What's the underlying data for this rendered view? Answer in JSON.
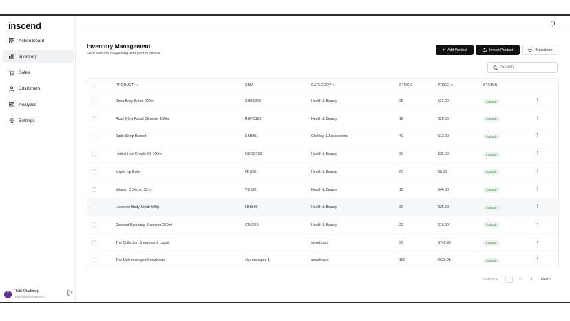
{
  "app": {
    "logo": "inscend"
  },
  "sidebar": {
    "items": [
      {
        "label": "Action Board",
        "icon": "grid-icon",
        "active": false
      },
      {
        "label": "Inventory",
        "icon": "chart-icon",
        "active": true
      },
      {
        "label": "Sales",
        "icon": "cart-icon",
        "active": false
      },
      {
        "label": "Customers",
        "icon": "users-icon",
        "active": false
      },
      {
        "label": "Analytics",
        "icon": "analytics-icon",
        "active": false
      },
      {
        "label": "Settings",
        "icon": "gear-icon",
        "active": false
      }
    ]
  },
  "user": {
    "initial": "T",
    "name": "Tobi Oladimeji",
    "email": "tobi@tobifeltbweese.i..."
  },
  "page": {
    "title": "Inventory Management",
    "subtitle": "Here's what's happening with your business."
  },
  "actions": {
    "add": "Add Product",
    "import": "Import Product",
    "brainstorm": "Brainstorm"
  },
  "search": {
    "placeholder": "Search"
  },
  "table": {
    "columns": {
      "product": "PRODUCT ↑↓",
      "sku": "SKU",
      "category": "CATEGORY ↑↓",
      "stock": "STOCK",
      "price": "PRICE ↑↓",
      "status": "STATUS"
    },
    "rows": [
      {
        "product": "Shea Body Butter 200ml",
        "sku": "SHBB200",
        "category": "Health & Beauty",
        "stock": "25",
        "price": "$22.00",
        "status": "In Stock"
      },
      {
        "product": "Rose Glow Facial Cleanser 150ml",
        "sku": "RGFC150",
        "category": "Health & Beauty",
        "stock": "18",
        "price": "$28.00",
        "status": "In Stock"
      },
      {
        "product": "Satin Sleep Bonnet",
        "sku": "SSB001",
        "category": "Clothing & Accessories",
        "stock": "40",
        "price": "$12.00",
        "status": "In Stock"
      },
      {
        "product": "Herbal Hair Growth Oil 100ml",
        "sku": "HHGO100",
        "category": "Health & Beauty",
        "stock": "30",
        "price": "$35.00",
        "status": "In Stock"
      },
      {
        "product": "Maple Lip Balm",
        "sku": "MLB05",
        "category": "Health & Beauty",
        "stock": "60",
        "price": "$8.00",
        "status": "In Stock"
      },
      {
        "product": "Vitamin C Serum 30ml",
        "sku": "VCS30",
        "category": "Health & Beauty",
        "stock": "15",
        "price": "$40.00",
        "status": "In Stock"
      },
      {
        "product": "Lavender Body Scrub 500g",
        "sku": "LBS500",
        "category": "Health & Beauty",
        "stock": "20",
        "price": "$28.00",
        "status": "In Stock"
      },
      {
        "product": "Coconut Hydrating Shampoo 250ml",
        "sku": "CHS250",
        "category": "Health & Beauty",
        "stock": "22",
        "price": "$18.00",
        "status": "In Stock"
      },
      {
        "product": "The Collection Snowboard: Liquid",
        "sku": "",
        "category": "snowboard",
        "stock": "50",
        "price": "$749.95",
        "status": "In Stock"
      },
      {
        "product": "The Multi-managed Snowboard",
        "sku": "sku-managed-1",
        "category": "snowboard",
        "stock": "100",
        "price": "$629.95",
        "status": "In Stock"
      }
    ]
  },
  "pagination": {
    "prev": "‹ Previous",
    "pages": [
      "1",
      "2",
      "3"
    ],
    "next": "Next ›"
  },
  "colors": {
    "primary": "#111111",
    "badge_bg": "#e7f5ea",
    "badge_text": "#2f7a3d",
    "avatar": "#5b2d8e"
  }
}
